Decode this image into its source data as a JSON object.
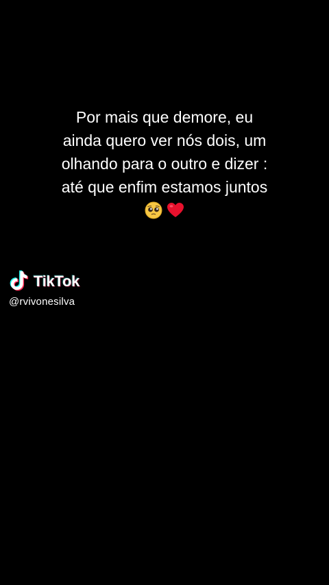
{
  "caption": {
    "lines": [
      "Por mais que demore, eu",
      "ainda quero ver nós dois, um",
      "olhando para o outro e dizer :",
      "até que enfim estamos juntos"
    ],
    "emojis": [
      "pleading-face-emoji",
      "red-heart-emoji"
    ]
  },
  "watermark": {
    "brand": "TikTok",
    "handle": "@rvivonesilva",
    "logo_icon": "tiktok-note-icon"
  },
  "colors": {
    "background": "#000000",
    "text": "#ffffff",
    "heart": "#e8112d",
    "tiktok_cyan": "#25f4ee",
    "tiktok_pink": "#fe2c55"
  }
}
